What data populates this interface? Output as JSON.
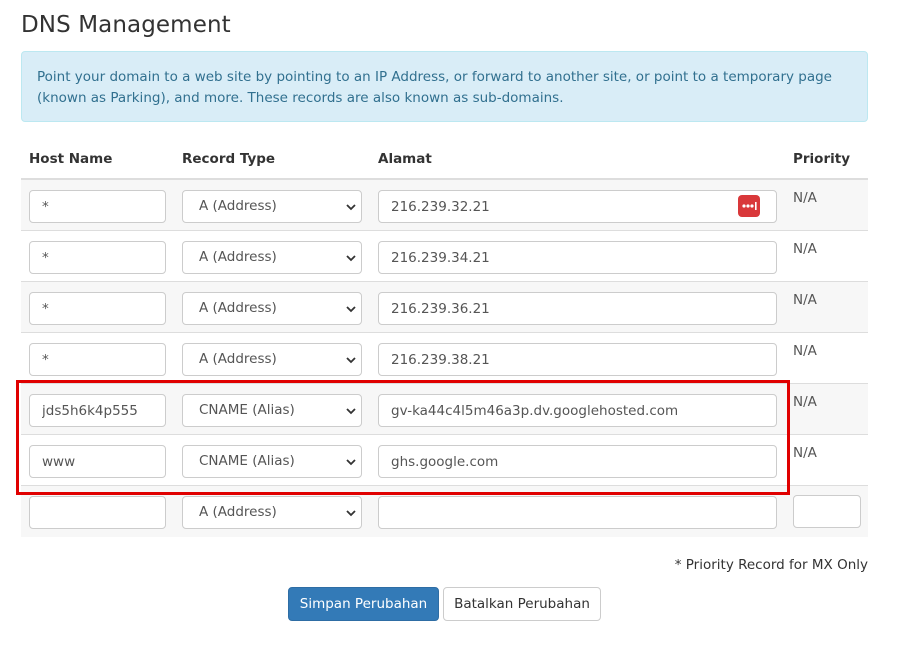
{
  "page": {
    "title": "DNS Management"
  },
  "info": {
    "text": "Point your domain to a web site by pointing to an IP Address, or forward to another site, or point to a temporary page (known as Parking), and more. These records are also known as sub-domains."
  },
  "table": {
    "headers": {
      "host": "Host Name",
      "type": "Record Type",
      "address": "Alamat",
      "priority": "Priority"
    },
    "rows": [
      {
        "host": "*",
        "type": "A (Address)",
        "address": "216.239.32.21",
        "priority": "N/A"
      },
      {
        "host": "*",
        "type": "A (Address)",
        "address": "216.239.34.21",
        "priority": "N/A"
      },
      {
        "host": "*",
        "type": "A (Address)",
        "address": "216.239.36.21",
        "priority": "N/A"
      },
      {
        "host": "*",
        "type": "A (Address)",
        "address": "216.239.38.21",
        "priority": "N/A"
      },
      {
        "host": "jds5h6k4p555",
        "type": "CNAME (Alias)",
        "address": "gv-ka44c4l5m46a3p.dv.googlehosted.com",
        "priority": "N/A"
      },
      {
        "host": "www",
        "type": "CNAME (Alias)",
        "address": "ghs.google.com",
        "priority": "N/A"
      }
    ],
    "new_row": {
      "host": "",
      "type": "A (Address)",
      "address": "",
      "priority": ""
    }
  },
  "footnote": "* Priority Record for MX Only",
  "buttons": {
    "save": "Simpan Perubahan",
    "cancel": "Batalkan Perubahan"
  },
  "colors": {
    "primary": "#337ab7",
    "info_bg": "#d9edf7",
    "info_text": "#31708f",
    "highlight": "#e00000",
    "password_icon": "#d9383a"
  },
  "icons": {
    "password_manager": "password-dots-icon",
    "select_arrow": "chevron-down-icon"
  }
}
